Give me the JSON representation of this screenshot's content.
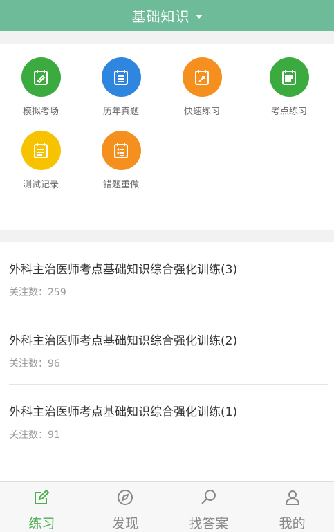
{
  "header": {
    "title": "基础知识",
    "icon": "caret-down-icon"
  },
  "grid": [
    {
      "label": "模拟考场",
      "color": "#3bab3f",
      "icon": "mock-exam-icon"
    },
    {
      "label": "历年真题",
      "color": "#2e86de",
      "icon": "past-papers-icon"
    },
    {
      "label": "快速练习",
      "color": "#f5901e",
      "icon": "quick-practice-icon"
    },
    {
      "label": "考点练习",
      "color": "#3bab3f",
      "icon": "key-points-icon"
    },
    {
      "label": "测试记录",
      "color": "#f7c300",
      "icon": "test-records-icon"
    },
    {
      "label": "错题重做",
      "color": "#f5901e",
      "icon": "redo-mistakes-icon"
    }
  ],
  "list": [
    {
      "title": "外科主治医师考点基础知识综合强化训练(3)",
      "meta_label": "关注数：",
      "count": "259"
    },
    {
      "title": "外科主治医师考点基础知识综合强化训练(2)",
      "meta_label": "关注数：",
      "count": "96"
    },
    {
      "title": "外科主治医师考点基础知识综合强化训练(1)",
      "meta_label": "关注数：",
      "count": "91"
    }
  ],
  "tabs": [
    {
      "label": "练习",
      "icon": "edit-icon",
      "active": true
    },
    {
      "label": "发现",
      "icon": "compass-icon",
      "active": false
    },
    {
      "label": "找答案",
      "icon": "search-icon",
      "active": false
    },
    {
      "label": "我的",
      "icon": "user-icon",
      "active": false
    }
  ],
  "colors": {
    "header": "#6dbb98",
    "active_tab": "#4caf50"
  }
}
